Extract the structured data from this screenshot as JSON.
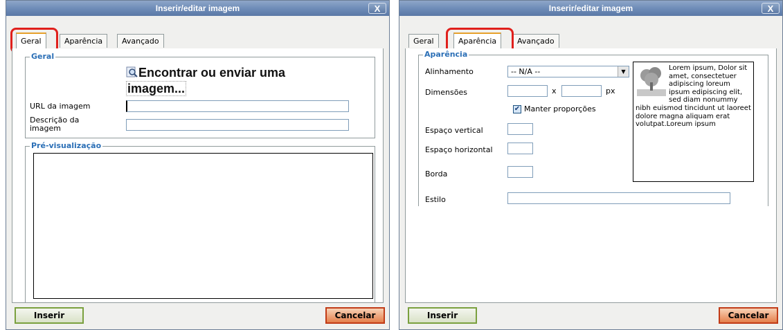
{
  "dialog_left": {
    "title": "Inserir/editar imagem",
    "close_label": "X",
    "tabs": [
      "Geral",
      "Aparência",
      "Avançado"
    ],
    "active_tab": "Geral",
    "general_legend": "Geral",
    "find_line1": "Encontrar ou enviar uma",
    "find_line2": "imagem...",
    "url_label": "URL da imagem",
    "url_value": "",
    "desc_label_line1": "Descrição da",
    "desc_label_line2": "imagem",
    "desc_value": "",
    "preview_legend": "Pré-visualização",
    "insert_button": "Inserir",
    "cancel_button": "Cancelar"
  },
  "dialog_right": {
    "title": "Inserir/editar imagem",
    "close_label": "X",
    "tabs": [
      "Geral",
      "Aparência",
      "Avançado"
    ],
    "active_tab": "Aparência",
    "appearance_legend": "Aparência",
    "align_label": "Alinhamento",
    "align_value": "-- N/A --",
    "dimensions_label": "Dimensões",
    "width_value": "",
    "dim_separator": "x",
    "height_value": "",
    "dim_unit": "px",
    "keep_ratio_label": "Manter proporções",
    "keep_ratio_checked": true,
    "vspace_label": "Espaço vertical",
    "vspace_value": "",
    "hspace_label": "Espaço horizontal",
    "hspace_value": "",
    "border_label": "Borda",
    "border_value": "",
    "style_label": "Estilo",
    "style_value": "",
    "sample_text": "Lorem ipsum, Dolor sit amet, consectetuer adipiscing loreum ipsum edipiscing elit, sed diam nonummy nibh euismod tincidunt ut laoreet dolore magna aliquam erat volutpat.Loreum ipsum",
    "insert_button": "Inserir",
    "cancel_button": "Cancelar"
  }
}
